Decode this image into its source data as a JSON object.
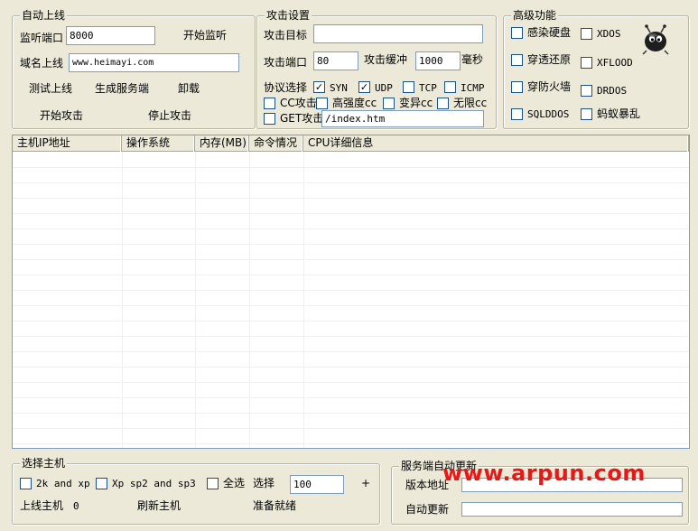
{
  "auto_online": {
    "title": "自动上线",
    "listen_port_label": "监听端口",
    "listen_port_value": "8000",
    "start_listen": "开始监听",
    "domain_label": "域名上线",
    "domain_value": "www.heimayi.com",
    "test_online": "测试上线",
    "gen_server": "生成服务端",
    "uninstall": "卸载",
    "start_attack": "开始攻击",
    "stop_attack": "停止攻击"
  },
  "attack_settings": {
    "title": "攻击设置",
    "target_label": "攻击目标",
    "target_value": "",
    "port_label": "攻击端口",
    "port_value": "80",
    "buffer_label": "攻击缓冲",
    "buffer_value": "1000",
    "ms": "毫秒",
    "protocol_label": "协议选择",
    "protocols": [
      {
        "label": "SYN",
        "checked": true
      },
      {
        "label": "UDP",
        "checked": true
      },
      {
        "label": "TCP",
        "checked": false
      },
      {
        "label": "ICMP",
        "checked": false
      }
    ],
    "cc_options": [
      {
        "label": "CC攻击",
        "checked": false
      },
      {
        "label": "高强度cc",
        "checked": false
      },
      {
        "label": "变异cc",
        "checked": false
      },
      {
        "label": "无限cc",
        "checked": false
      }
    ],
    "get_label": "GET攻击",
    "get_value": "/index.htm"
  },
  "advanced": {
    "title": "高级功能",
    "options": [
      {
        "label": "感染硬盘",
        "checked": false
      },
      {
        "label": "XDOS",
        "checked": false
      },
      {
        "label": "穿透还原",
        "checked": false
      },
      {
        "label": "XFLOOD",
        "checked": false
      },
      {
        "label": "穿防火墙",
        "checked": false
      },
      {
        "label": "DRDOS",
        "checked": false
      },
      {
        "label": "SQLDDOS",
        "checked": false
      },
      {
        "label": "蚂蚁暴乱",
        "checked": false
      }
    ]
  },
  "host_table": {
    "columns": [
      "主机IP地址",
      "操作系统",
      "内存(MB)",
      "命令情况",
      "CPU详细信息"
    ],
    "rows": []
  },
  "select_host": {
    "title": "选择主机",
    "opt_2k_xp": "2k and xp",
    "opt_xp_sp": "Xp sp2 and sp3",
    "select_all": "全选",
    "select_label": "选择",
    "select_count": "100",
    "plus": "+",
    "online_label": "上线主机",
    "online_count": "0",
    "refresh": "刷新主机",
    "status": "准备就绪"
  },
  "auto_update": {
    "title": "服务端自动更新",
    "version_label": "版本地址",
    "version_value": "",
    "auto_label": "自动更新",
    "auto_value": ""
  },
  "watermark": "www.arpun.com",
  "colors": {
    "window_bg": "#ece9d8",
    "watermark": "#e81818",
    "input_border": "#7f9db9"
  }
}
